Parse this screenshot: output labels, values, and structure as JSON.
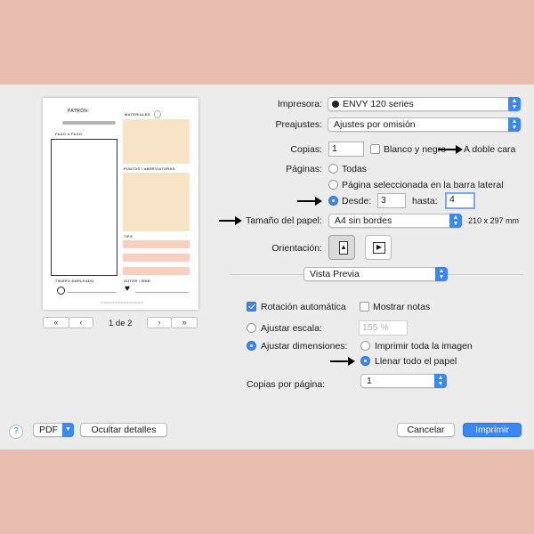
{
  "printer": {
    "label": "Impresora:",
    "value": "ENVY 120 series"
  },
  "presets": {
    "label": "Preajustes:",
    "value": "Ajustes por omisión"
  },
  "copies": {
    "label": "Copias:",
    "value": "1",
    "bw_label": "Blanco y negro",
    "duplex_label": "A doble cara"
  },
  "pages": {
    "label": "Páginas:",
    "all_label": "Todas",
    "selected_label": "Página seleccionada en la barra lateral",
    "from_label": "Desde:",
    "from_value": "3",
    "to_label": "hasta:",
    "to_value": "4"
  },
  "paper": {
    "label": "Tamaño del papel:",
    "value": "A4 sin bordes",
    "dims": "210 x 297 mm"
  },
  "orientation": {
    "label": "Orientación:"
  },
  "section": {
    "value": "Vista Previa"
  },
  "options": {
    "auto_rotate_label": "Rotación automática",
    "show_notes_label": "Mostrar notas",
    "scale_label": "Ajustar escala:",
    "scale_value": "155 %",
    "fit_label": "Ajustar dimensiones:",
    "print_entire_label": "Imprimir toda la imagen",
    "fill_label": "Llenar todo el papel",
    "copies_per_page_label": "Copias por página:",
    "copies_per_page_value": "1"
  },
  "preview": {
    "page_indicator": "1 de 2",
    "title": "PATRÓN:",
    "materials": "MATERIALES",
    "step_by_step": "PASO A PASO",
    "points": "PUNTOS / ABREVIATURAS",
    "tips": "TIPS",
    "time": "TIEMPO EMPLEADO",
    "author": "AUTOR / WEB",
    "footer": "@@@@@@@@@@@@@@@"
  },
  "footer": {
    "help": "?",
    "pdf": "PDF",
    "hide_details": "Ocultar detalles",
    "cancel": "Cancelar",
    "print": "Imprimir"
  },
  "colors": {
    "accent": "#3b87f3",
    "background": "#e8bcae",
    "panel": "#ececec",
    "beige_block": "#f7e3c6",
    "peach_block": "#f9d0bf"
  }
}
